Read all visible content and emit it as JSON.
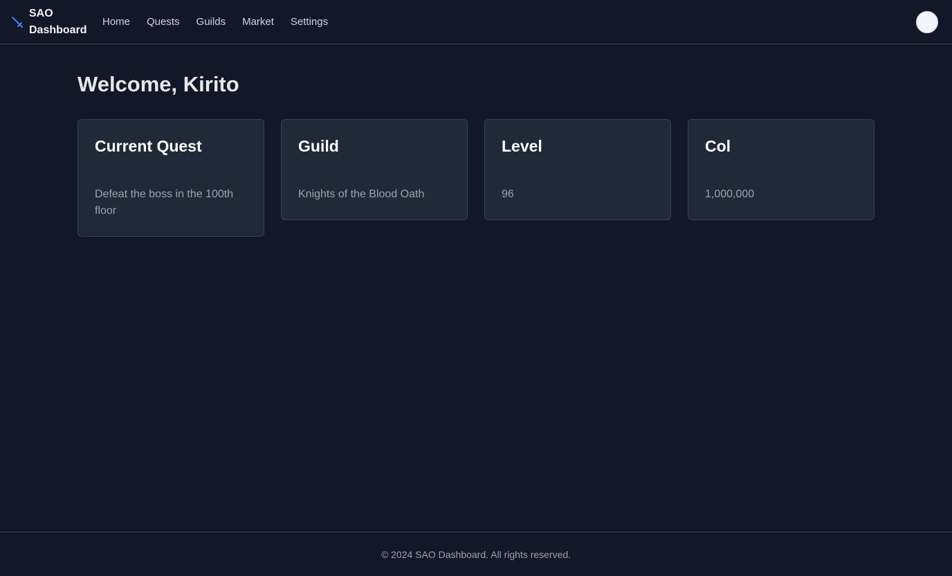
{
  "brand": {
    "name": "SAO Dashboard",
    "icon": "sword-icon",
    "icon_color": "#3b82f6"
  },
  "nav": {
    "items": [
      {
        "label": "Home"
      },
      {
        "label": "Quests"
      },
      {
        "label": "Guilds"
      },
      {
        "label": "Market"
      },
      {
        "label": "Settings"
      }
    ]
  },
  "main": {
    "title": "Welcome, Kirito",
    "cards": [
      {
        "title": "Current Quest",
        "value": "Defeat the boss in the 100th floor"
      },
      {
        "title": "Guild",
        "value": "Knights of the Blood Oath"
      },
      {
        "title": "Level",
        "value": "96"
      },
      {
        "title": "Col",
        "value": "1,000,000"
      }
    ]
  },
  "footer": {
    "text": "© 2024 SAO Dashboard. All rights reserved."
  },
  "colors": {
    "background": "#121827",
    "card": "#1f2937",
    "border": "#374151",
    "muted_text": "#9ca3af",
    "accent": "#3b82f6"
  }
}
